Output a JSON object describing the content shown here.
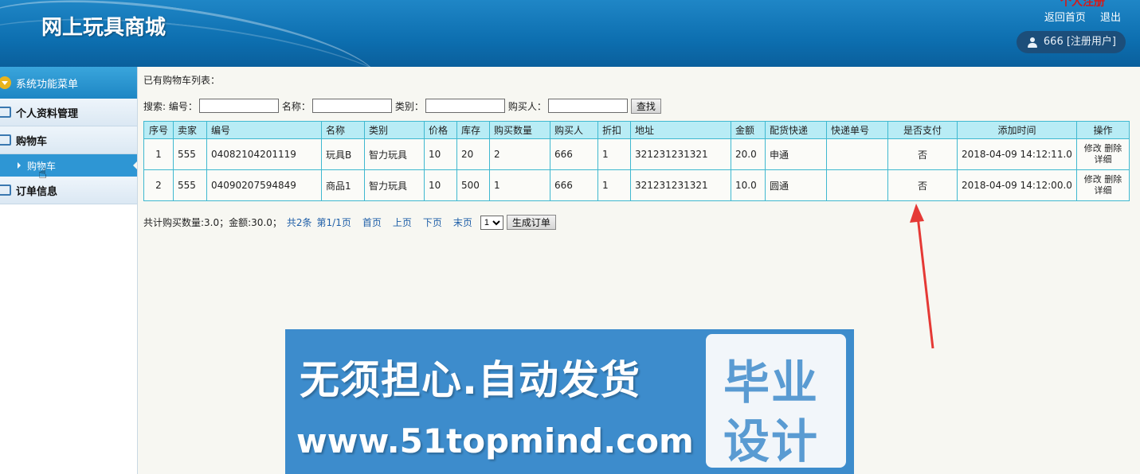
{
  "header": {
    "site_title": "网上玩具商城",
    "top_red_text": "个人注册",
    "home_link": "返回首页",
    "logout_link": "退出",
    "user_label": "666 [注册用户]"
  },
  "sidebar": {
    "menu_title": "系统功能菜单",
    "sections": [
      {
        "label": "个人资料管理"
      },
      {
        "label": "购物车"
      },
      {
        "label": "订单信息"
      }
    ],
    "active_sub": "购物车"
  },
  "main": {
    "list_title": "已有购物车列表：",
    "search": {
      "prefix": "搜索: 编号：",
      "name_label": "名称：",
      "category_label": "类别：",
      "buyer_label": "购买人：",
      "button": "查找"
    },
    "table": {
      "headers": [
        "序号",
        "卖家",
        "编号",
        "名称",
        "类别",
        "价格",
        "库存",
        "购买数量",
        "购买人",
        "折扣",
        "地址",
        "金额",
        "配货快递",
        "快递单号",
        "是否支付",
        "添加时间",
        "操作"
      ],
      "rows": [
        {
          "no": "1",
          "seller": "555",
          "code": "04082104201119",
          "name": "玩具B",
          "category": "智力玩具",
          "price": "10",
          "stock": "20",
          "qty": "2",
          "buyer": "666",
          "discount": "1",
          "address": "321231231321",
          "amount": "20.0",
          "courier": "申通",
          "tracking": "",
          "paid": "否",
          "added": "2018-04-09 14:12:11.0"
        },
        {
          "no": "2",
          "seller": "555",
          "code": "04090207594849",
          "name": "商品1",
          "category": "智力玩具",
          "price": "10",
          "stock": "500",
          "qty": "1",
          "buyer": "666",
          "discount": "1",
          "address": "321231231321",
          "amount": "10.0",
          "courier": "圆通",
          "tracking": "",
          "paid": "否",
          "added": "2018-04-09 14:12:00.0"
        }
      ],
      "ops": {
        "edit": "修改",
        "delete": "删除",
        "detail": "详细"
      }
    },
    "pager": {
      "summary": "共计购买数量:3.0；金额:30.0；",
      "total": "共2条",
      "page_info": "第1/1页",
      "first": "首页",
      "prev": "上页",
      "next": "下页",
      "last": "末页",
      "page_select": "1",
      "generate_button": "生成订单"
    }
  },
  "banner": {
    "slogan": "无须担心.自动发货",
    "url": "www.51topmind.com",
    "box_line1": "毕业",
    "box_line2": "设计"
  },
  "colors": {
    "header_blue": "#0d6fb0",
    "table_header": "#b8ecf5",
    "table_border": "#3fb8d0",
    "link": "#1f5fa8",
    "arrow_red": "#e53935",
    "banner_blue": "#3d8ccc"
  }
}
